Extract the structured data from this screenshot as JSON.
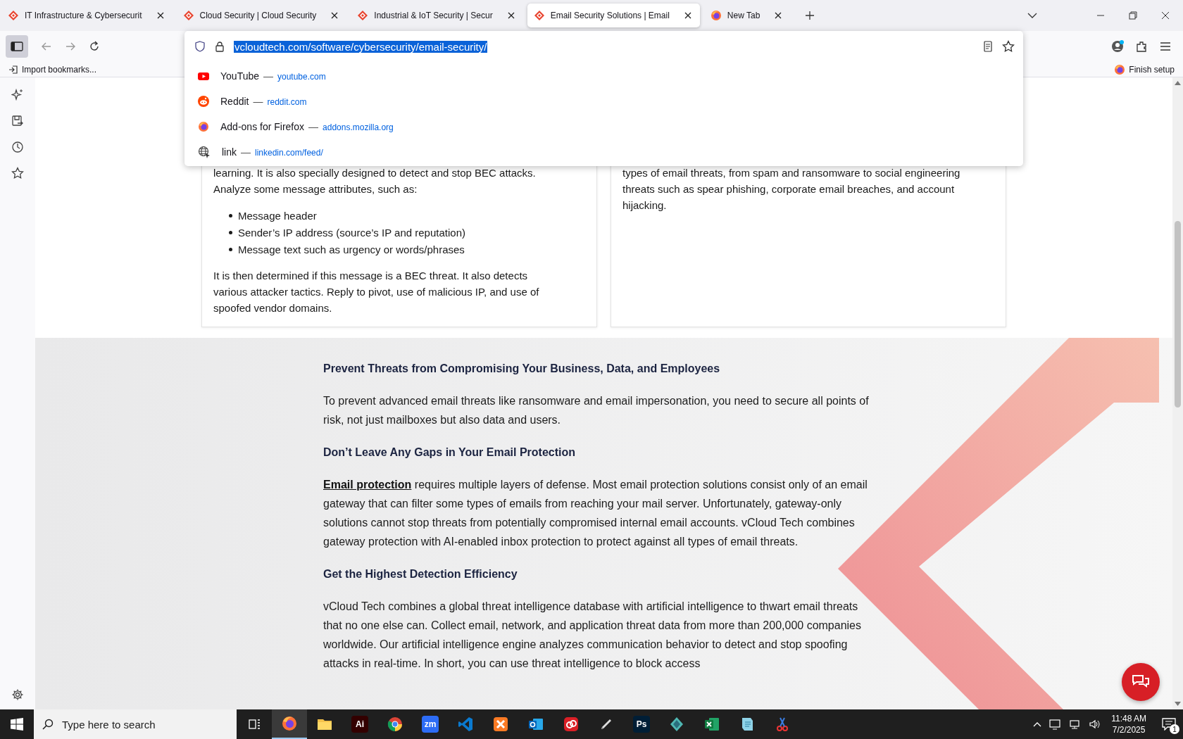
{
  "tabs": [
    {
      "title": "IT Infrastructure & Cybersecurit",
      "kind": "site",
      "selected": false
    },
    {
      "title": "Cloud Security | Cloud Security",
      "kind": "site",
      "selected": false
    },
    {
      "title": "Industrial & IoT Security | Secur",
      "kind": "site",
      "selected": false
    },
    {
      "title": "Email Security Solutions | Email",
      "kind": "site",
      "selected": true
    },
    {
      "title": "New Tab",
      "kind": "firefox",
      "selected": false
    }
  ],
  "address_bar": {
    "url": "vcloudtech.com/software/cybersecurity/email-security/",
    "selected": true
  },
  "suggestions": [
    {
      "title": "YouTube",
      "separator": "—",
      "url": "youtube.com",
      "kind": "youtube"
    },
    {
      "title": "Reddit",
      "separator": "—",
      "url": "reddit.com",
      "kind": "reddit"
    },
    {
      "title": "Add-ons for Firefox",
      "separator": "—",
      "url": "addons.mozilla.org",
      "kind": "firefox"
    },
    {
      "title": "link",
      "separator": "—",
      "url": "linkedin.com/feed/",
      "kind": "globe"
    }
  ],
  "bookmarks_bar": {
    "import": "Import bookmarks...",
    "finish_setup": "Finish setup"
  },
  "cards": [
    {
      "blocks": [
        {
          "kind": "paragraph",
          "text": "learning. It is also specially designed to detect and stop BEC attacks. Analyze some message attributes, such as:"
        },
        {
          "kind": "list",
          "items": [
            "Message header",
            "Sender’s IP address (source’s IP and reputation)",
            "Message text such as urgency or words/phrases"
          ]
        },
        {
          "kind": "paragraph",
          "text": "It is then determined if this message is a BEC threat. It also detects various attacker tactics. Reply to pivot, use of malicious IP, and use of spoofed vendor domains."
        }
      ]
    },
    {
      "blocks": [
        {
          "kind": "paragraph",
          "text": "types of email threats, from spam and ransomware to social engineering threats such as spear phishing, corporate email breaches, and account hijacking."
        }
      ]
    }
  ],
  "section": {
    "blocks": [
      {
        "kind": "heading",
        "text": "Prevent Threats from Compromising Your Business, Data, and Employees"
      },
      {
        "kind": "paragraph",
        "text": "To prevent advanced email threats like ransomware and email impersonation, you need to secure all points of risk, not just mailboxes but also data and users."
      },
      {
        "kind": "heading",
        "text": "Don’t Leave Any Gaps in Your Email Protection"
      },
      {
        "kind": "paragraph",
        "text": "**Email protection** requires multiple layers of defense. Most email protection solutions consist only of an email gateway that can filter some types of emails from reaching your mail server. Unfortunately, gateway-only solutions cannot stop threats from potentially compromised internal email accounts. vCloud Tech combines gateway protection with AI-enabled inbox protection to protect against all types of email threats."
      },
      {
        "kind": "heading",
        "text": "Get the Highest Detection Efficiency"
      },
      {
        "kind": "paragraph",
        "text": "vCloud Tech combines a global threat intelligence database with artificial intelligence to thwart email threats that no one else can. Collect email, network, and application threat data from more than 200,000 companies worldwide. Our artificial intelligence engine analyzes communication behavior to detect and stop spoofing attacks in real-time. In short, you can use threat intelligence to block access"
      }
    ]
  },
  "taskbar": {
    "search_placeholder": "Type here to search",
    "time": "11:48 AM",
    "date": "7/2/2025",
    "notifications": "1",
    "apps": [
      {
        "kind": "firefox",
        "active": true
      },
      {
        "kind": "folder",
        "active": false
      },
      {
        "kind": "tile",
        "label": "Ai",
        "color": "#330000",
        "active": false
      },
      {
        "kind": "chrome",
        "active": false
      },
      {
        "kind": "tile",
        "label": "zm",
        "color": "#2d6cf5",
        "active": false
      },
      {
        "kind": "vscode",
        "active": false
      },
      {
        "kind": "xampp",
        "active": false
      },
      {
        "kind": "outlook",
        "active": false
      },
      {
        "kind": "cloud",
        "active": false
      },
      {
        "kind": "pen",
        "active": false
      },
      {
        "kind": "tile",
        "label": "Ps",
        "color": "#001e36",
        "active": false
      },
      {
        "kind": "gem",
        "active": false
      },
      {
        "kind": "excel",
        "active": false
      },
      {
        "kind": "notepad",
        "active": false
      },
      {
        "kind": "snip",
        "active": false
      }
    ]
  }
}
